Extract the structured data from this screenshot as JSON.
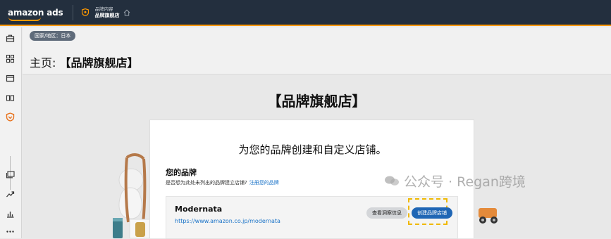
{
  "topbar": {
    "logo_text": "amazon ads",
    "breadcrumb_small": "品牌内容",
    "breadcrumb_main": "品牌旗舰店",
    "accent_color": "#ff9900"
  },
  "sidebar": {
    "icons": [
      "briefcase-icon",
      "grid-icon",
      "wallet-icon",
      "layout-icon",
      "shield-icon",
      "media-icon",
      "trend-icon",
      "bar-chart-icon",
      "more-icon"
    ]
  },
  "main": {
    "country_pill": "国家/地区：日本",
    "title_prefix": "主页:",
    "title_bold": "【品牌旗舰店】"
  },
  "store": {
    "heading": "【品牌旗舰店】",
    "panel_heading": "为您的品牌创建和自定义店铺。",
    "my_brands_label": "您的品牌",
    "question_text": "是否想为此处未列出的品牌建立店铺?",
    "register_link": "注册您的品牌",
    "brand": {
      "name": "Modernata",
      "url": "https://www.amazon.co.jp/modernata",
      "insight_button": "查看洞察信息",
      "create_button": "创建品牌店铺"
    }
  },
  "watermark": {
    "text": "公众号 · Regan跨境"
  }
}
